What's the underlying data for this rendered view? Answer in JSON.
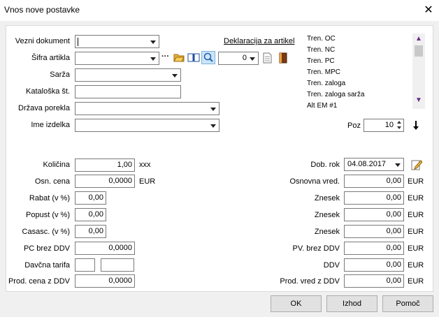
{
  "window": {
    "title": "Vnos nove postavke",
    "close": "✕"
  },
  "form": {
    "vezni_dokument": {
      "label": "Vezni dokument",
      "value": ""
    },
    "deklaracija_link": "Deklaracija za artikel",
    "sifra_artikla": {
      "label": "Šifra artikla",
      "value": "",
      "ellipsis": "···",
      "count": "0"
    },
    "sarza": {
      "label": "Sarža",
      "value": ""
    },
    "kataloska": {
      "label": "Kataloška št.",
      "value": ""
    },
    "drzava": {
      "label": "Država porekla",
      "value": ""
    },
    "ime_izdelka": {
      "label": "Ime izdelka",
      "value": ""
    },
    "poz": {
      "label": "Poz",
      "value": "10"
    },
    "kolicina": {
      "label": "Količina",
      "value": "1,00",
      "unit": "xxx"
    },
    "osn_cena": {
      "label": "Osn. cena",
      "value": "0,0000",
      "unit": "EUR"
    },
    "rabat": {
      "label": "Rabat (v %)",
      "value": "0,00"
    },
    "popust": {
      "label": "Popust (v %)",
      "value": "0,00"
    },
    "casasc": {
      "label": "Casasc. (v %)",
      "value": "0,00"
    },
    "pc_brez_ddv": {
      "label": "PC brez DDV",
      "value": "0,0000"
    },
    "davcna_tarifa": {
      "label": "Davčna tarifa",
      "value1": "",
      "value2": ""
    },
    "prod_cena": {
      "label": "Prod. cena z DDV",
      "value": "0,0000"
    },
    "dob_rok": {
      "label": "Dob. rok",
      "value": "04.08.2017"
    },
    "osnovna_vred": {
      "label": "Osnovna vred.",
      "value": "0,00",
      "unit": "EUR"
    },
    "znesek1": {
      "label": "Znesek",
      "value": "0,00",
      "unit": "EUR"
    },
    "znesek2": {
      "label": "Znesek",
      "value": "0,00",
      "unit": "EUR"
    },
    "znesek3": {
      "label": "Znesek",
      "value": "0,00",
      "unit": "EUR"
    },
    "pv_brez_ddv": {
      "label": "PV. brez DDV",
      "value": "0,00",
      "unit": "EUR"
    },
    "ddv": {
      "label": "DDV",
      "value": "0,00",
      "unit": "EUR"
    },
    "prod_vred": {
      "label": "Prod. vred z DDV",
      "value": "0,00",
      "unit": "EUR"
    }
  },
  "info_list": {
    "items": [
      "Tren. OC",
      "Tren. NC",
      "Tren. PC",
      "Tren. MPC",
      "Tren. zaloga",
      "Tren. zaloga sarža",
      "Alt EM #1"
    ]
  },
  "buttons": {
    "ok": "OK",
    "izhod": "Izhod",
    "pomoc": "Pomoč"
  },
  "icons": {
    "folder": "folder-icon",
    "book": "book-icon",
    "search": "magnifier-icon",
    "doc": "document-icon",
    "binder": "binder-icon",
    "arrow_down": "arrow-down-icon",
    "edit": "edit-icon"
  }
}
